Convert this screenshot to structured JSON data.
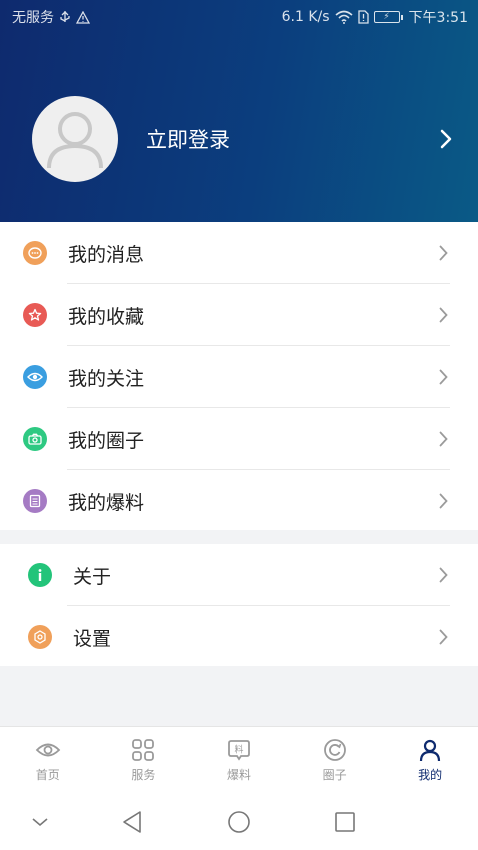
{
  "status_bar": {
    "carrier": "无服务",
    "speed": "6.1 K/s",
    "time": "下午3:51"
  },
  "profile": {
    "login_label": "立即登录"
  },
  "menu_group1": [
    {
      "label": "我的消息",
      "icon": "message-icon",
      "color": "#f0a05a"
    },
    {
      "label": "我的收藏",
      "icon": "star-icon",
      "color": "#e85a55"
    },
    {
      "label": "我的关注",
      "icon": "eye-icon",
      "color": "#3a9ee0"
    },
    {
      "label": "我的圈子",
      "icon": "camera-icon",
      "color": "#2ec982"
    },
    {
      "label": "我的爆料",
      "icon": "document-icon",
      "color": "#a57bc4"
    }
  ],
  "menu_group2": [
    {
      "label": "关于",
      "icon": "info-icon",
      "color": "#23c47a"
    },
    {
      "label": "设置",
      "icon": "settings-icon",
      "color": "#f0a05a"
    }
  ],
  "tabbar": [
    {
      "label": "首页",
      "icon": "eye-icon",
      "active": false
    },
    {
      "label": "服务",
      "icon": "grid-icon",
      "active": false
    },
    {
      "label": "爆料",
      "icon": "report-icon",
      "active": false
    },
    {
      "label": "圈子",
      "icon": "circle-icon",
      "active": false
    },
    {
      "label": "我的",
      "icon": "person-icon",
      "active": true
    }
  ],
  "colors": {
    "header_start": "#0e2a6e",
    "header_end": "#0a5a86",
    "active_tab": "#0e2a6e"
  }
}
